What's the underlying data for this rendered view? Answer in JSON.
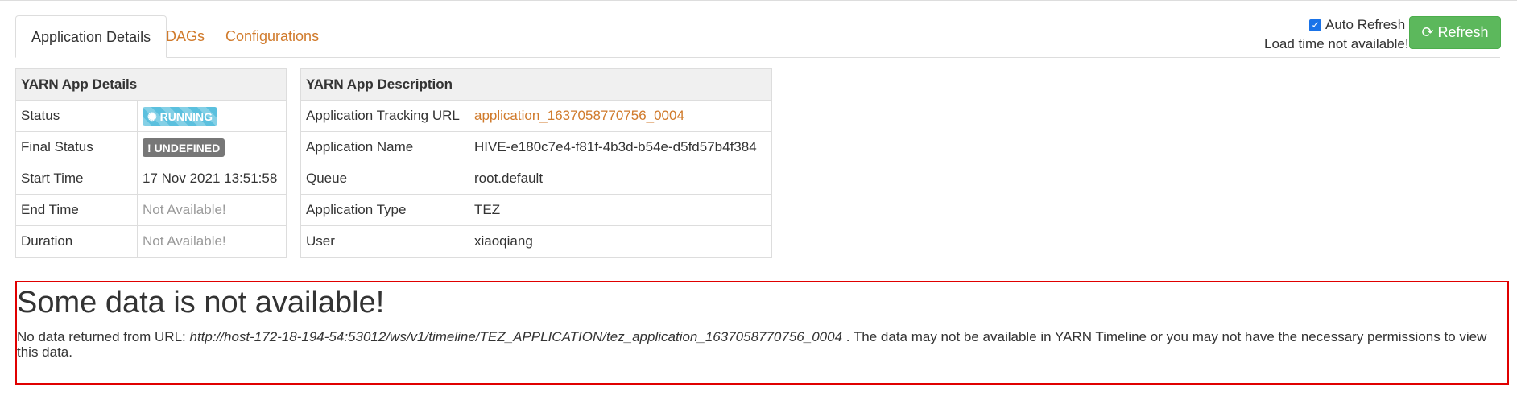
{
  "tabs": [
    {
      "label": "Application Details",
      "active": true
    },
    {
      "label": "DAGs",
      "active": false
    },
    {
      "label": "Configurations",
      "active": false
    }
  ],
  "refresh": {
    "auto_refresh_label": "Auto Refresh",
    "auto_refresh_checked": true,
    "load_time_text": "Load time not available!",
    "button_label": "Refresh"
  },
  "app_details": {
    "title": "YARN App Details",
    "rows": [
      {
        "key": "Status",
        "value": "RUNNING"
      },
      {
        "key": "Final Status",
        "value": "UNDEFINED"
      },
      {
        "key": "Start Time",
        "value": "17 Nov 2021 13:51:58"
      },
      {
        "key": "End Time",
        "value": "Not Available!"
      },
      {
        "key": "Duration",
        "value": "Not Available!"
      }
    ]
  },
  "app_description": {
    "title": "YARN App Description",
    "rows": [
      {
        "key": "Application Tracking URL",
        "value": "application_1637058770756_0004"
      },
      {
        "key": "Application Name",
        "value": "HIVE-e180c7e4-f81f-4b3d-b54e-d5fd57b4f384"
      },
      {
        "key": "Queue",
        "value": "root.default"
      },
      {
        "key": "Application Type",
        "value": "TEZ"
      },
      {
        "key": "User",
        "value": "xiaoqiang"
      }
    ]
  },
  "error": {
    "title": "Some data is not available!",
    "prefix": "No data returned from URL: ",
    "url": "http://host-172-18-194-54:53012/ws/v1/timeline/TEZ_APPLICATION/tez_application_1637058770756_0004",
    "suffix": " . The data may not be available in YARN Timeline or you may not have the necessary permissions to view this data."
  },
  "colors": {
    "link": "#d07a2b",
    "running_badge": "#5bc0de",
    "undefined_badge": "#777777",
    "refresh_button": "#5cb85c",
    "error_border": "#e00000"
  }
}
